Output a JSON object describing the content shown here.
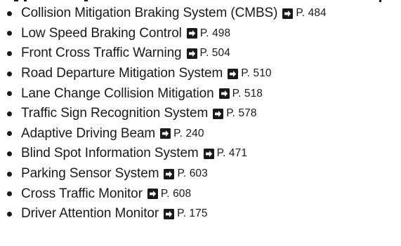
{
  "items": [
    {
      "label": "Collision Mitigation Braking System (CMBS)",
      "page": "P. 484"
    },
    {
      "label": "Low Speed Braking Control",
      "page": "P. 498"
    },
    {
      "label": "Front Cross Traffic Warning",
      "page": "P. 504"
    },
    {
      "label": "Road Departure Mitigation System",
      "page": "P. 510"
    },
    {
      "label": "Lane Change Collision Mitigation",
      "page": "P. 518"
    },
    {
      "label": "Traffic Sign Recognition System",
      "page": "P. 578"
    },
    {
      "label": "Adaptive Driving Beam",
      "page": "P. 240"
    },
    {
      "label": "Blind Spot Information System",
      "page": "P. 471"
    },
    {
      "label": "Parking Sensor System",
      "page": "P. 603"
    },
    {
      "label": "Cross Traffic Monitor",
      "page": "P. 608"
    },
    {
      "label": "Driver Attention Monitor",
      "page": "P. 175"
    }
  ],
  "icons": {
    "bullet": "bullet-dot",
    "reference": "arrow-right-box-icon"
  }
}
